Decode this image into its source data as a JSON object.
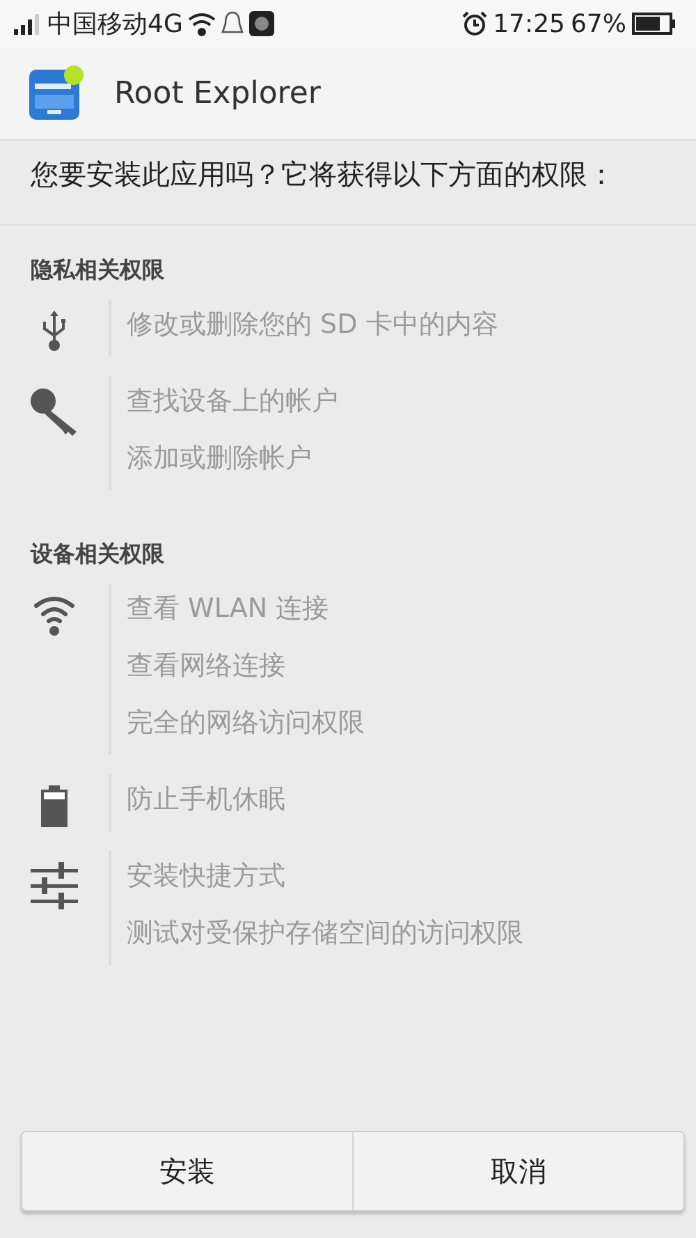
{
  "status_bar": {
    "carrier": "中国移动4G",
    "time": "17:25",
    "battery": "67%"
  },
  "header": {
    "title": "Root Explorer"
  },
  "prompt": "您要安装此应用吗？它将获得以下方面的权限：",
  "sections": [
    {
      "title": "隐私相关权限",
      "groups": [
        {
          "kind": "usb",
          "items": [
            "修改或删除您的 SD 卡中的内容"
          ]
        },
        {
          "kind": "key",
          "items": [
            "查找设备上的帐户",
            "添加或删除帐户"
          ]
        }
      ]
    },
    {
      "title": "设备相关权限",
      "groups": [
        {
          "kind": "wifi",
          "items": [
            "查看 WLAN 连接",
            "查看网络连接",
            "完全的网络访问权限"
          ]
        },
        {
          "kind": "battery",
          "items": [
            "防止手机休眠"
          ]
        },
        {
          "kind": "sliders",
          "items": [
            "安装快捷方式",
            "测试对受保护存储空间的访问权限"
          ]
        }
      ]
    }
  ],
  "buttons": [
    "安装",
    "取消"
  ]
}
